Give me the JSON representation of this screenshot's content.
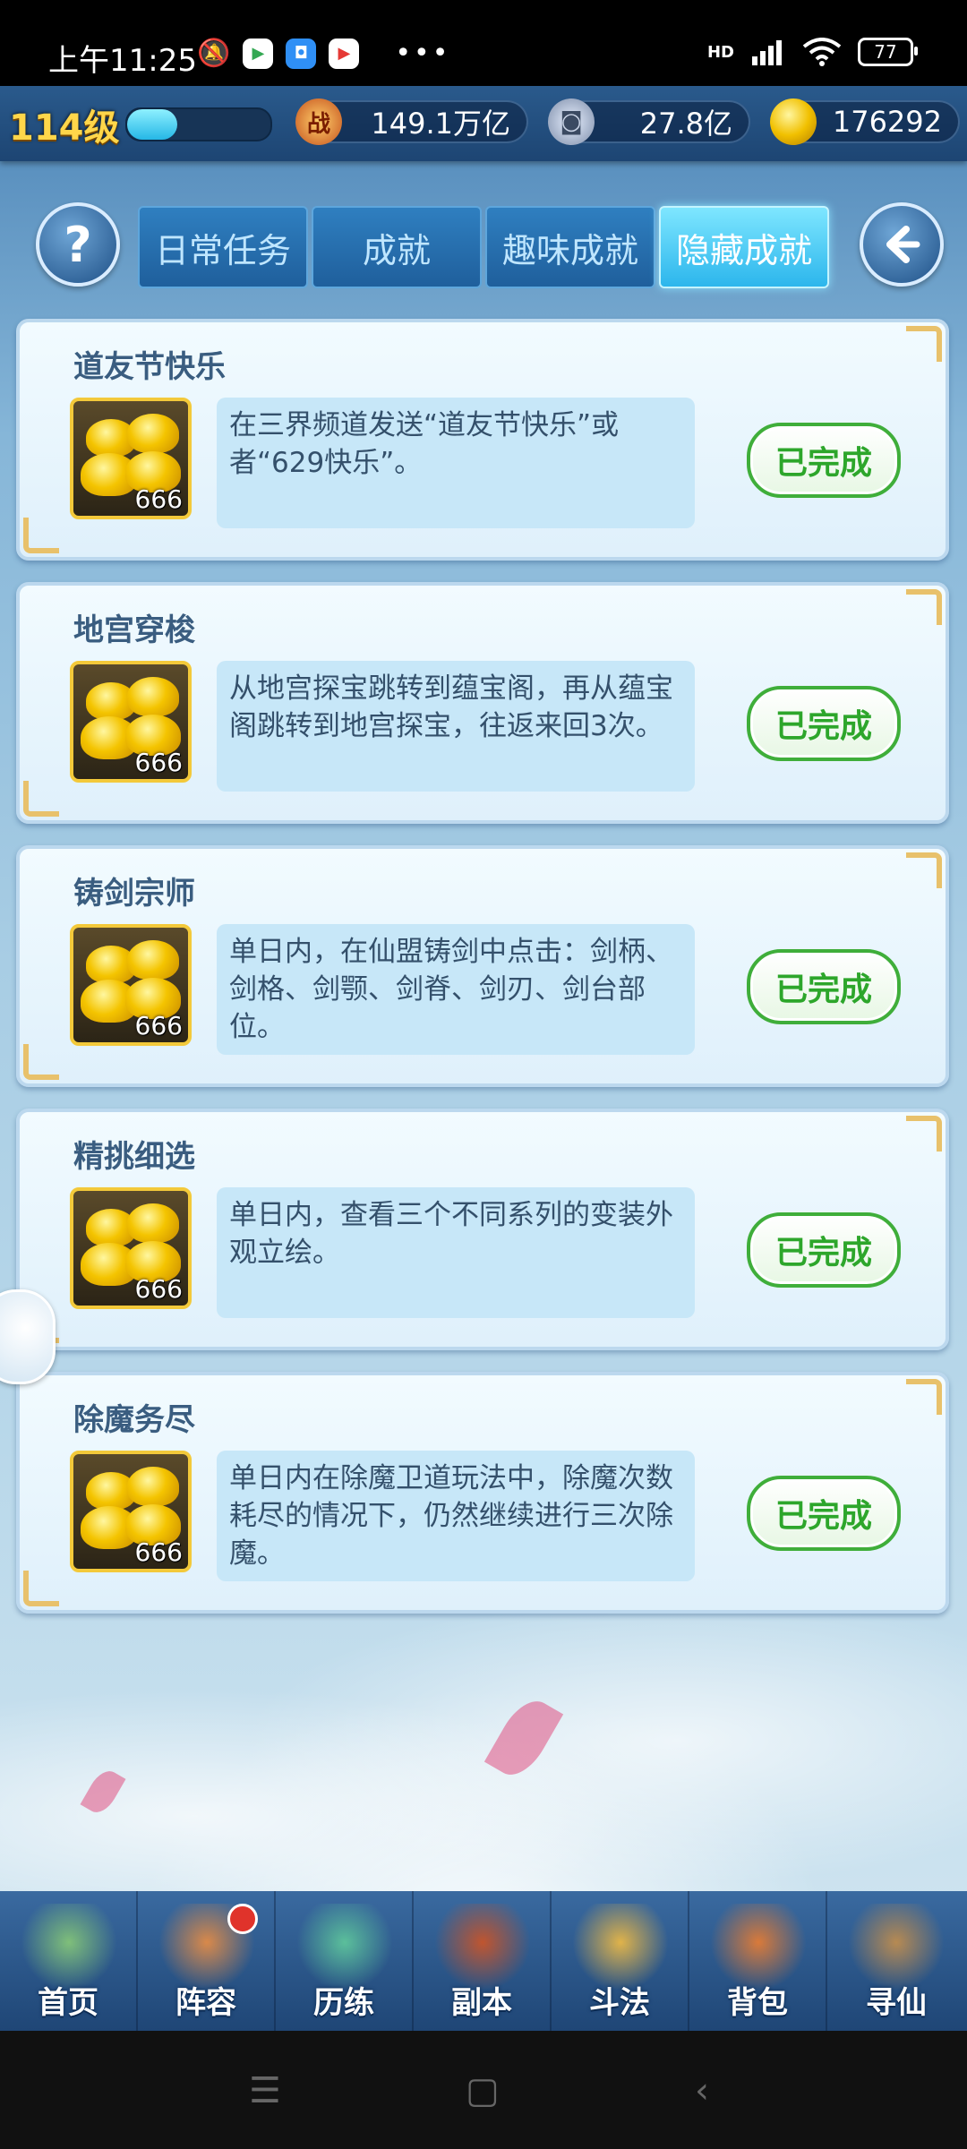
{
  "status_bar": {
    "time": "上午11:25",
    "battery": "77",
    "network": "HD"
  },
  "resources": {
    "level": "114级",
    "xp_fraction": 0.35,
    "combat_power": "149.1万亿",
    "coins": "27.8亿",
    "gold": "176292",
    "combat_icon_char": "战"
  },
  "tabs": [
    {
      "label": "日常任务",
      "active": false
    },
    {
      "label": "成就",
      "active": false
    },
    {
      "label": "趣味成就",
      "active": false
    },
    {
      "label": "隐藏成就",
      "active": true
    }
  ],
  "help_button": "?",
  "achievements": [
    {
      "title": "道友节快乐",
      "reward_qty": "666",
      "desc": "在三界频道发送“道友节快乐”或者“629快乐”。",
      "status": "已完成"
    },
    {
      "title": "地宫穿梭",
      "reward_qty": "666",
      "desc": "从地宫探宝跳转到蕴宝阁，再从蕴宝阁跳转到地宫探宝，往返来回3次。",
      "status": "已完成"
    },
    {
      "title": "铸剑宗师",
      "reward_qty": "666",
      "desc": "单日内，在仙盟铸剑中点击：剑柄、剑格、剑颚、剑脊、剑刃、剑台部位。",
      "status": "已完成"
    },
    {
      "title": "精挑细选",
      "reward_qty": "666",
      "desc": "单日内，查看三个不同系列的变装外观立绘。",
      "status": "已完成"
    },
    {
      "title": "除魔务尽",
      "reward_qty": "666",
      "desc": "单日内在除魔卫道玩法中，除魔次数耗尽的情况下，仍然继续进行三次除魔。",
      "status": "已完成"
    }
  ],
  "bottom_nav": [
    {
      "label": "首页",
      "icon": "home-icon",
      "color": "#7fbf7a"
    },
    {
      "label": "阵容",
      "icon": "lineup-icon",
      "color": "#d9894a",
      "badge": true
    },
    {
      "label": "历练",
      "icon": "training-icon",
      "color": "#5bbf9b"
    },
    {
      "label": "副本",
      "icon": "dungeon-icon",
      "color": "#c0552f"
    },
    {
      "label": "斗法",
      "icon": "duel-icon",
      "color": "#e0b34a"
    },
    {
      "label": "背包",
      "icon": "bag-icon",
      "color": "#d97a3a"
    },
    {
      "label": "寻仙",
      "icon": "seek-immortal-icon",
      "color": "#b78a52"
    }
  ],
  "colors": {
    "done_green": "#2da62b",
    "gold": "#ffd64a",
    "tab_active": "#2cb6ec"
  }
}
